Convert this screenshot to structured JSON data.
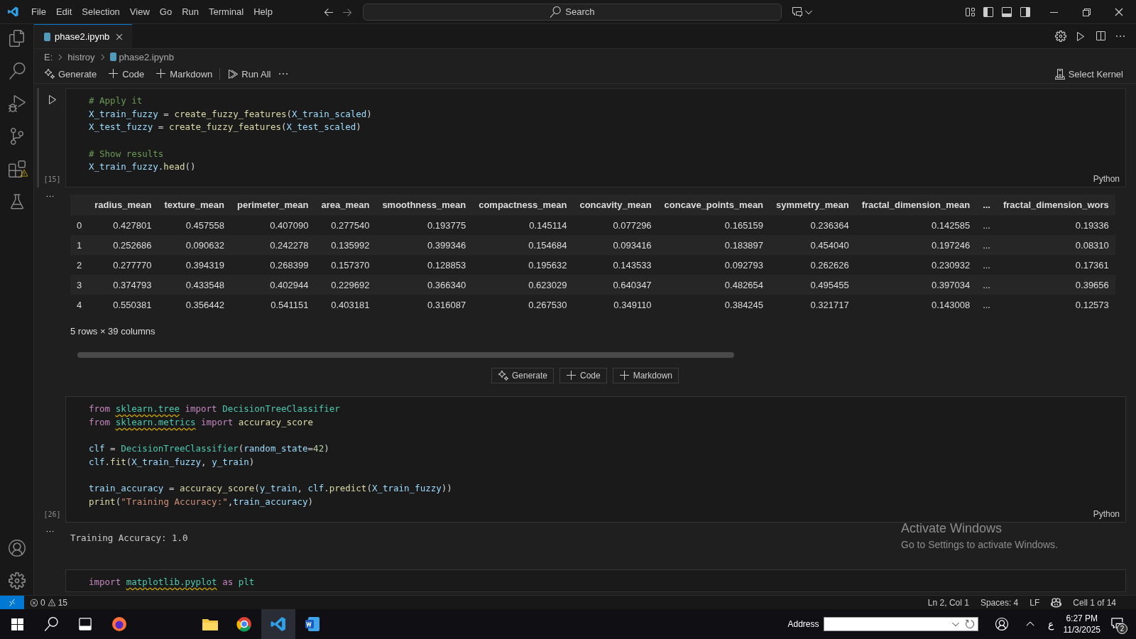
{
  "menu": [
    "File",
    "Edit",
    "Selection",
    "View",
    "Go",
    "Run",
    "Terminal",
    "Help"
  ],
  "search": {
    "placeholder": "Search"
  },
  "tab": {
    "label": "phase2.ipynb",
    "selected": true
  },
  "breadcrumb": [
    "E:",
    "histroy",
    "phase2.ipynb"
  ],
  "toolbar": {
    "buttons": [
      {
        "label": "Generate",
        "kind": "generate"
      },
      {
        "label": "Code",
        "kind": "add"
      },
      {
        "label": "Markdown",
        "kind": "add"
      },
      {
        "label": "Run All",
        "kind": "run"
      }
    ],
    "kernel": "Select Kernel"
  },
  "cells": [
    {
      "focused": true,
      "execution": "[15]",
      "language": "Python",
      "blocks": [
        [
          [
            {
              "t": "# Apply it",
              "kind": "comment"
            }
          ],
          [
            {
              "t": "X_train_fuzzy",
              "kind": "var"
            },
            {
              "t": " = ",
              "kind": "plain"
            },
            {
              "t": "create_fuzzy_features",
              "kind": "func"
            },
            {
              "t": "(",
              "kind": "plain"
            },
            {
              "t": "X_train_scaled",
              "kind": "var"
            },
            {
              "t": ")",
              "kind": "plain"
            }
          ],
          [
            {
              "t": "X_test_fuzzy",
              "kind": "var"
            },
            {
              "t": " = ",
              "kind": "plain"
            },
            {
              "t": "create_fuzzy_features",
              "kind": "func"
            },
            {
              "t": "(",
              "kind": "plain"
            },
            {
              "t": "X_test_scaled",
              "kind": "var"
            },
            {
              "t": ")",
              "kind": "plain"
            }
          ]
        ],
        [
          [
            {
              "t": "# Show results",
              "kind": "comment"
            }
          ],
          [
            {
              "t": "X_train_fuzzy.",
              "kind": "var"
            },
            {
              "t": "head",
              "kind": "func"
            },
            {
              "t": "()",
              "kind": "plain"
            }
          ]
        ]
      ],
      "output": {
        "kind": "table",
        "columns": [
          "radius_mean",
          "texture_mean",
          "perimeter_mean",
          "area_mean",
          "smoothness_mean",
          "compactness_mean",
          "concavity_mean",
          "concave_points_mean",
          "symmetry_mean",
          "fractal_dimension_mean",
          "...",
          "fractal_dimension_wors"
        ],
        "rows": [
          {
            "index": "0",
            "values": [
              "0.427801",
              "0.457558",
              "0.407090",
              "0.277540",
              "0.193775",
              "0.145114",
              "0.077296",
              "0.165159",
              "0.236364",
              "0.142585",
              "...",
              "0.19336"
            ]
          },
          {
            "index": "1",
            "values": [
              "0.252686",
              "0.090632",
              "0.242278",
              "0.135992",
              "0.399346",
              "0.154684",
              "0.093416",
              "0.183897",
              "0.454040",
              "0.197246",
              "...",
              "0.08310"
            ]
          },
          {
            "index": "2",
            "values": [
              "0.277770",
              "0.394319",
              "0.268399",
              "0.157370",
              "0.128853",
              "0.195632",
              "0.143533",
              "0.092793",
              "0.262626",
              "0.230932",
              "...",
              "0.17361"
            ]
          },
          {
            "index": "3",
            "values": [
              "0.374793",
              "0.433548",
              "0.402944",
              "0.229692",
              "0.366340",
              "0.623029",
              "0.640347",
              "0.482654",
              "0.495455",
              "0.397034",
              "...",
              "0.39656"
            ]
          },
          {
            "index": "4",
            "values": [
              "0.550381",
              "0.356442",
              "0.541151",
              "0.403181",
              "0.316087",
              "0.267530",
              "0.349110",
              "0.384245",
              "0.321717",
              "0.143008",
              "...",
              "0.12573"
            ]
          }
        ],
        "summary": "5 rows × 39 columns"
      }
    },
    {
      "focused": false,
      "execution": "[26]",
      "language": "Python",
      "blocks": [
        [
          [
            {
              "t": "from ",
              "kind": "kw"
            },
            {
              "t": "sklearn.tree",
              "kind": "mod",
              "warning": true
            },
            {
              "t": " import ",
              "kind": "kw"
            },
            {
              "t": "DecisionTreeClassifier",
              "kind": "cls"
            }
          ],
          [
            {
              "t": "from ",
              "kind": "kw"
            },
            {
              "t": "sklearn.metrics",
              "kind": "mod",
              "warning": true
            },
            {
              "t": " import ",
              "kind": "kw"
            },
            {
              "t": "accuracy_score",
              "kind": "func"
            }
          ]
        ],
        [
          [
            {
              "t": "clf",
              "kind": "var"
            },
            {
              "t": " = ",
              "kind": "plain"
            },
            {
              "t": "DecisionTreeClassifier",
              "kind": "cls"
            },
            {
              "t": "(",
              "kind": "plain"
            },
            {
              "t": "random_state",
              "kind": "var"
            },
            {
              "t": "=",
              "kind": "plain"
            },
            {
              "t": "42",
              "kind": "num"
            },
            {
              "t": ")",
              "kind": "plain"
            }
          ],
          [
            {
              "t": "clf",
              "kind": "var"
            },
            {
              "t": ".",
              "kind": "plain"
            },
            {
              "t": "fit",
              "kind": "func"
            },
            {
              "t": "(",
              "kind": "plain"
            },
            {
              "t": "X_train_fuzzy",
              "kind": "var"
            },
            {
              "t": ", ",
              "kind": "plain"
            },
            {
              "t": "y_train",
              "kind": "var"
            },
            {
              "t": ")",
              "kind": "plain"
            }
          ]
        ],
        [
          [
            {
              "t": "train_accuracy",
              "kind": "var"
            },
            {
              "t": " = ",
              "kind": "plain"
            },
            {
              "t": "accuracy_score",
              "kind": "func"
            },
            {
              "t": "(",
              "kind": "plain"
            },
            {
              "t": "y_train",
              "kind": "var"
            },
            {
              "t": ", ",
              "kind": "plain"
            },
            {
              "t": "clf",
              "kind": "var"
            },
            {
              "t": ".",
              "kind": "plain"
            },
            {
              "t": "predict",
              "kind": "func"
            },
            {
              "t": "(",
              "kind": "plain"
            },
            {
              "t": "X_train_fuzzy",
              "kind": "var"
            },
            {
              "t": "))",
              "kind": "plain"
            }
          ],
          [
            {
              "t": "print",
              "kind": "func"
            },
            {
              "t": "(",
              "kind": "plain"
            },
            {
              "t": "\"Training Accuracy:\"",
              "kind": "str"
            },
            {
              "t": ",",
              "kind": "plain"
            },
            {
              "t": "train_accuracy",
              "kind": "var"
            },
            {
              "t": ")",
              "kind": "plain"
            }
          ]
        ]
      ],
      "output": {
        "kind": "text",
        "text": "Training Accuracy: 1.0"
      }
    },
    {
      "focused": false,
      "blocks": [
        [
          [
            {
              "t": "import ",
              "kind": "kw"
            },
            {
              "t": "matplotlib.pyplot",
              "kind": "mod",
              "warning": true
            },
            {
              "t": " as ",
              "kind": "kw"
            },
            {
              "t": "plt",
              "kind": "mod"
            }
          ]
        ]
      ]
    }
  ],
  "insert_bar": [
    {
      "label": "Generate",
      "kind": "generate"
    },
    {
      "label": "Code",
      "kind": "add"
    },
    {
      "label": "Markdown",
      "kind": "add"
    }
  ],
  "activation": {
    "title": "Activate Windows",
    "text": "Go to Settings to activate Windows."
  },
  "status_bar": {
    "errors": "0",
    "warnings": "15",
    "items": [
      {
        "label": "Ln 2, Col 1",
        "kind": "text"
      },
      {
        "label": "Spaces: 4",
        "kind": "text"
      },
      {
        "label": "LF",
        "kind": "text"
      },
      {
        "kind": "copilot"
      },
      {
        "label": "Cell 1 of 14",
        "kind": "text"
      }
    ]
  },
  "taskbar": {
    "address_label": "Address",
    "input_language": "ع",
    "time": "6:27 PM",
    "date": "11/3/2025",
    "notifications": "2"
  }
}
